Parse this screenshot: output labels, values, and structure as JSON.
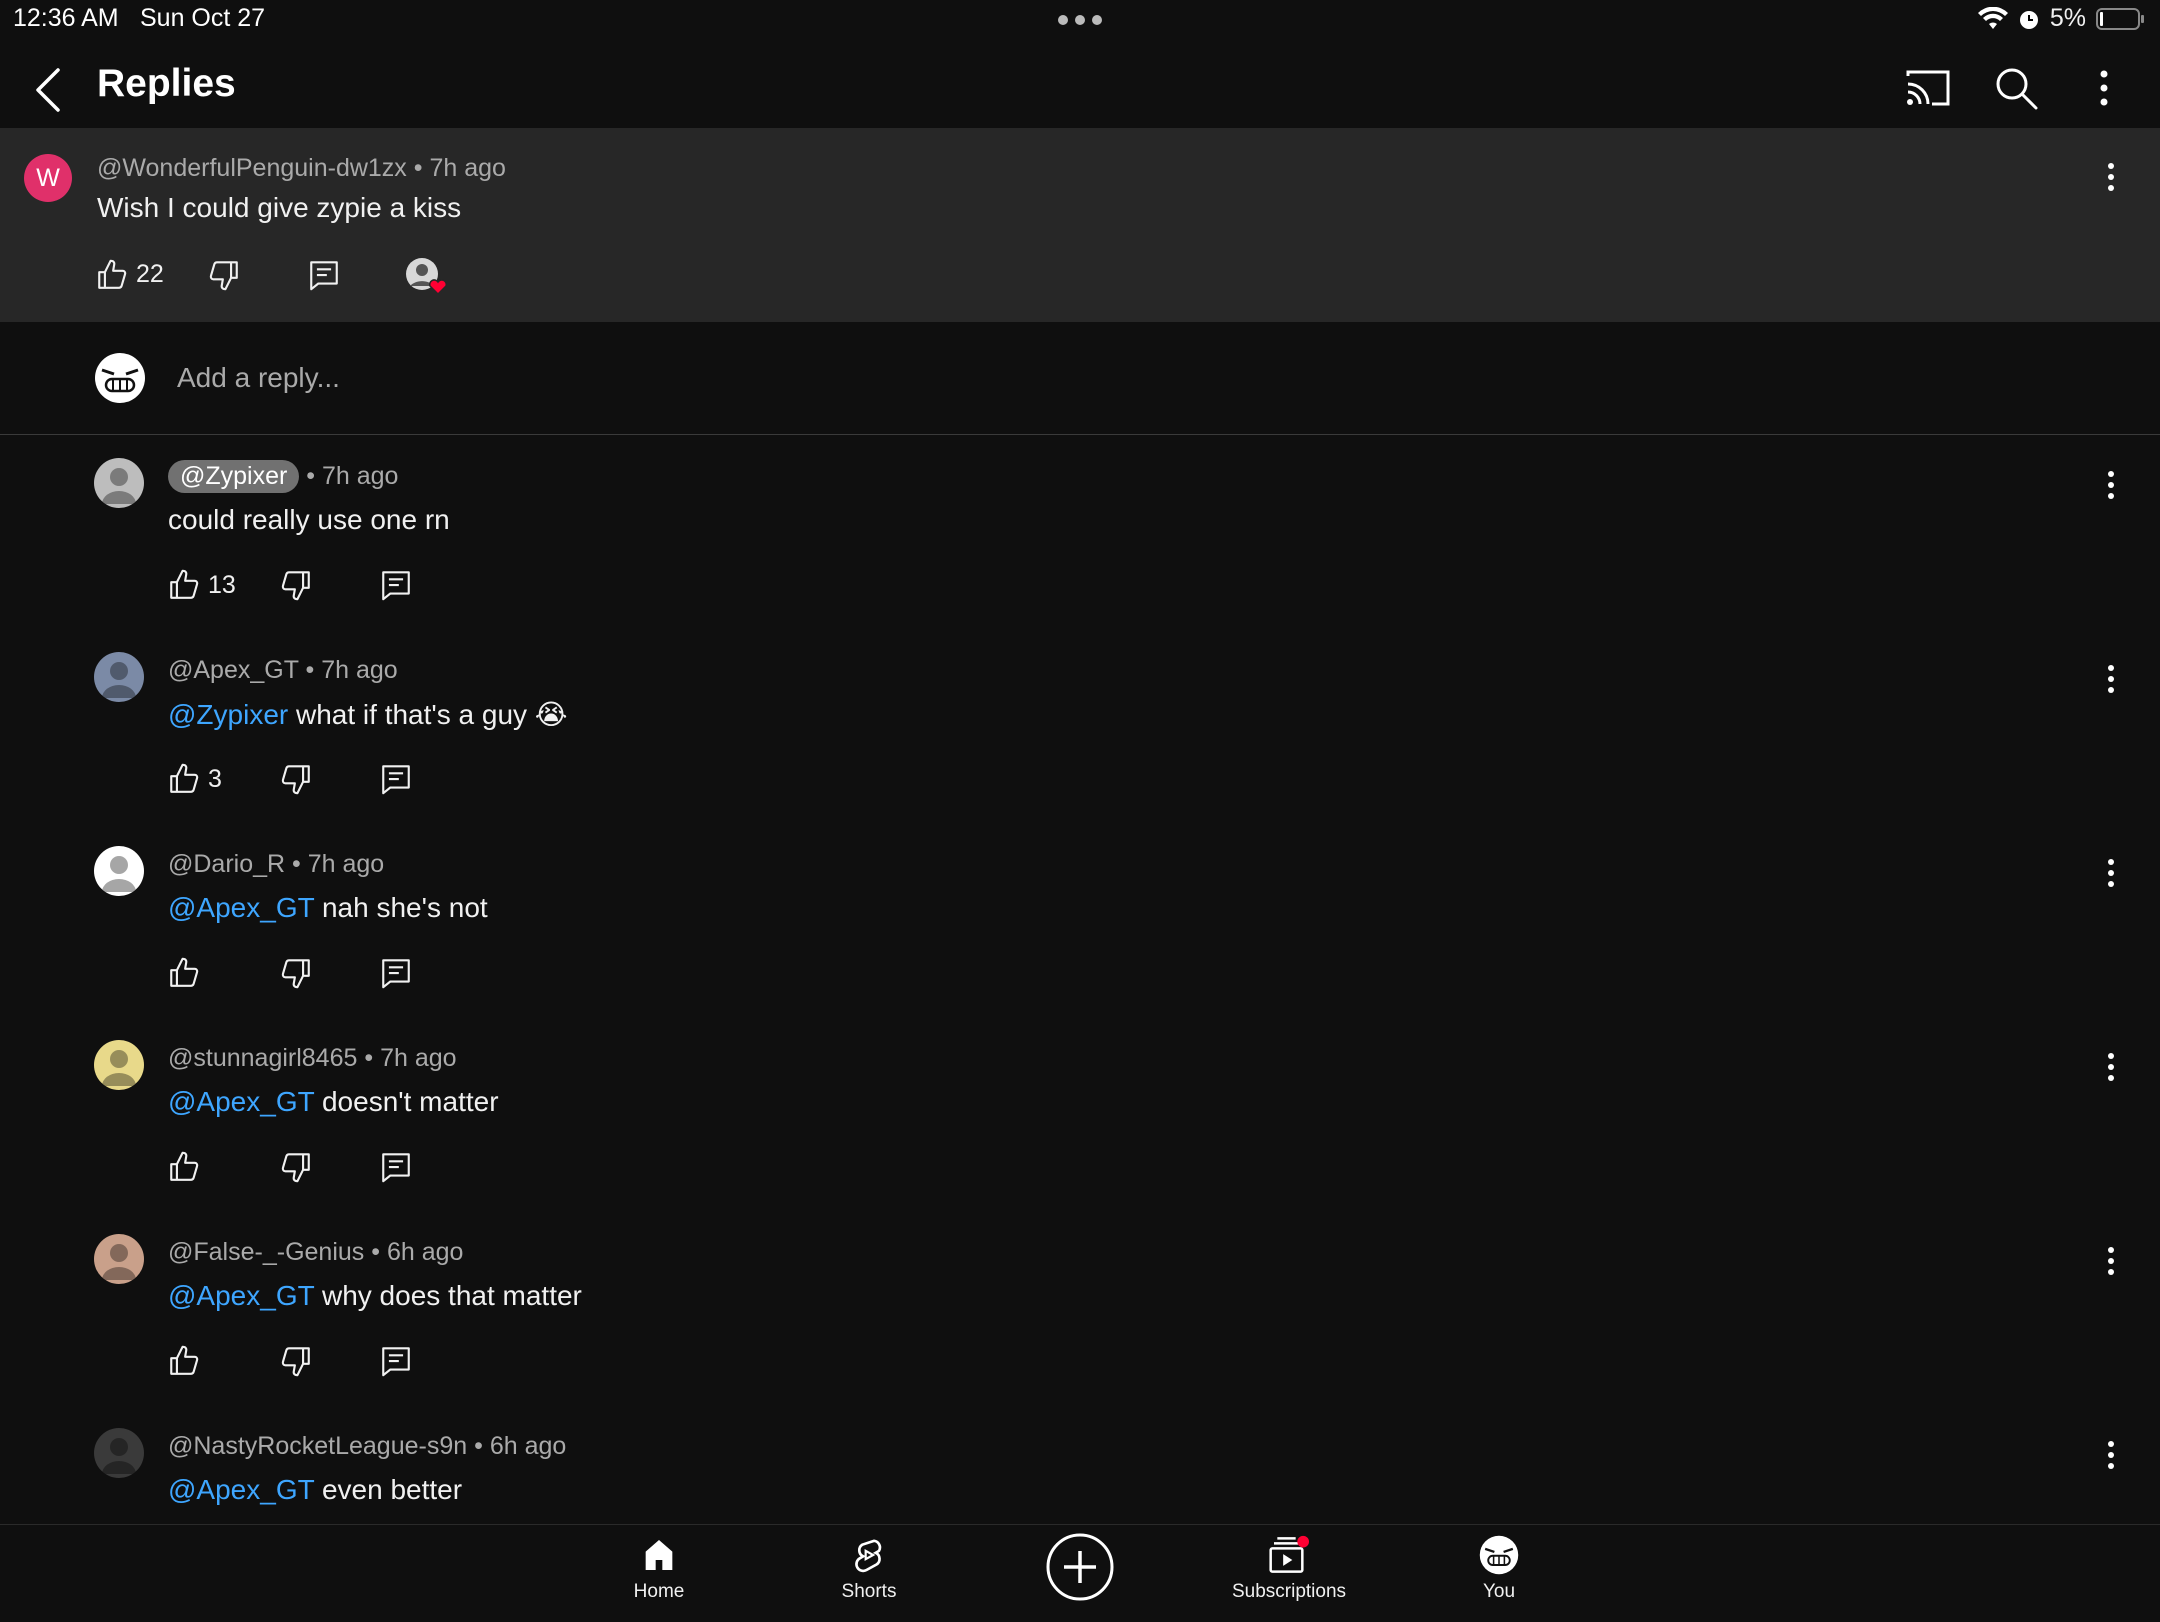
{
  "status_bar": {
    "time": "12:36 AM",
    "date": "Sun Oct 27",
    "battery": "5%"
  },
  "header": {
    "title": "Replies"
  },
  "parent_comment": {
    "author": "@WonderfulPenguin-dw1zx",
    "age": "7h ago",
    "avatar_letter": "W",
    "text": "Wish I could give zypie a kiss",
    "likes": "22"
  },
  "add_reply": {
    "placeholder": "Add a reply..."
  },
  "replies": [
    {
      "author": "@Zypixer",
      "age": "7h ago",
      "mention": "",
      "text": "could really use one rn",
      "likes": "13"
    },
    {
      "author": "@Apex_GT",
      "age": "7h ago",
      "mention": "@Zypixer",
      "text": " what if that's a guy 😭",
      "likes": "3"
    },
    {
      "author": "@Dario_R",
      "age": "7h ago",
      "mention": "@Apex_GT",
      "text": " nah she's not",
      "likes": ""
    },
    {
      "author": "@stunnagirl8465",
      "age": "7h ago",
      "mention": "@Apex_GT",
      "text": "  doesn't matter",
      "likes": ""
    },
    {
      "author": "@False-_-Genius",
      "age": "6h ago",
      "mention": "@Apex_GT",
      "text": " why does that matter",
      "likes": ""
    },
    {
      "author": "@NastyRocketLeague-s9n",
      "age": "6h ago",
      "mention": "@Apex_GT",
      "text": " even better",
      "likes": ""
    }
  ],
  "bottom_nav": {
    "home": "Home",
    "shorts": "Shorts",
    "subscriptions": "Subscriptions",
    "you": "You"
  },
  "colors": {
    "background": "#0f0f0f",
    "parent_highlight": "#272727",
    "mention": "#3ea6ff",
    "avatar_w": "#e0306a",
    "notification_dot": "#ff0033"
  },
  "icons": [
    "chevron-left-icon",
    "cast-icon",
    "search-icon",
    "more-vert-icon",
    "thumb-up-icon",
    "thumb-down-icon",
    "reply-icon",
    "creator-heart-icon",
    "home-icon",
    "shorts-icon",
    "create-icon",
    "subscriptions-icon",
    "wifi-icon",
    "alarm-icon",
    "battery-icon"
  ]
}
